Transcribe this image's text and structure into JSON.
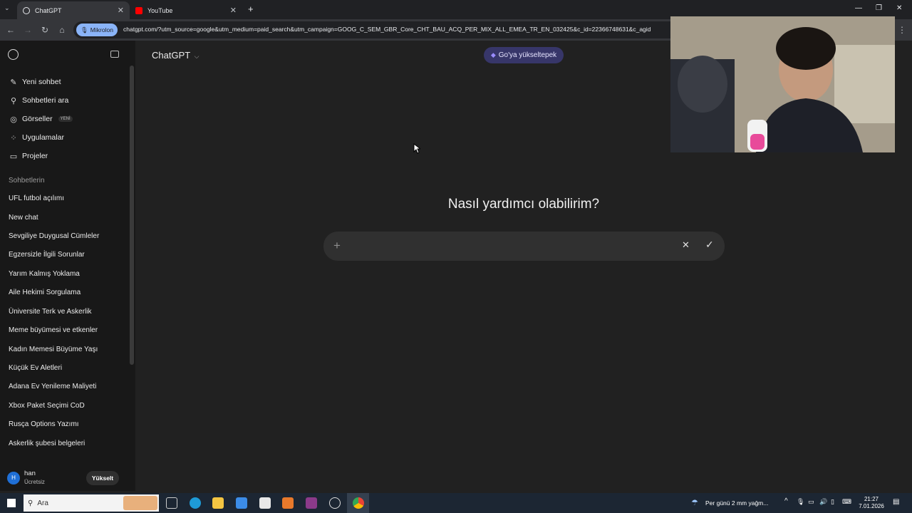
{
  "browser": {
    "tabs": [
      {
        "title": "ChatGPT",
        "active": true
      },
      {
        "title": "YouTube",
        "active": false
      }
    ],
    "profile_chip": "Mikrolon",
    "url": "chatgpt.com/?utm_source=google&utm_medium=paid_search&utm_campaign=GOOG_C_SEM_GBR_Core_CHT_BAU_ACQ_PER_MIX_ALL_EMEA_TR_EN_032425&c_id=22366748631&c_agid"
  },
  "sidebar": {
    "nav": [
      {
        "label": "Yeni sohbet",
        "icon": "edit-icon"
      },
      {
        "label": "Sohbetleri ara",
        "icon": "search-icon"
      },
      {
        "label": "Görseller",
        "icon": "image-icon",
        "badge": "YENİ"
      },
      {
        "label": "Uygulamalar",
        "icon": "apps-icon"
      },
      {
        "label": "Projeler",
        "icon": "folder-icon"
      }
    ],
    "section_title": "Sohbetlerin",
    "chats": [
      "UFL futbol açılımı",
      "New chat",
      "Sevgiliye Duygusal Cümleler",
      "Egzersizle İlgili Sorunlar",
      "Yarım Kalmış Yoklama",
      "Aile Hekimi Sorgulama",
      "Üniversite Terk ve Askerlik",
      "Meme büyümesi ve etkenler",
      "Kadın Memesi Büyüme Yaşı",
      "Küçük Ev Aletleri",
      "Adana Ev Yenileme Maliyeti",
      "Xbox Paket Seçimi CoD",
      "Rusça Options Yazımı",
      "Askerlik şubesi belgeleri"
    ],
    "user": {
      "initial": "H",
      "name": "han",
      "plan": "Ücretsiz",
      "upgrade": "Yükselt"
    }
  },
  "main": {
    "model": "ChatGPT",
    "upgrade_pill": "Go'ya yükseltерek",
    "greeting": "Nasıl yardımcı olabilirim?"
  },
  "taskbar": {
    "search": "Ara",
    "weather": "Per günü 2 mm yağm...",
    "time": "21:27",
    "date": "7.01.2026"
  }
}
